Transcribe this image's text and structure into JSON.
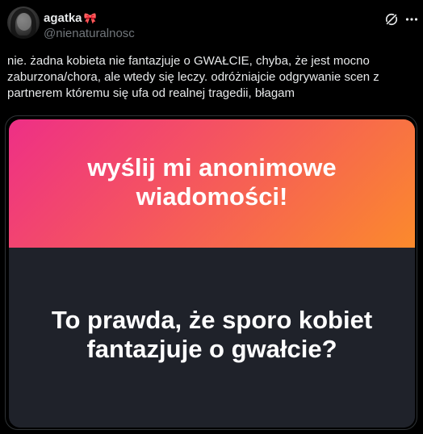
{
  "post": {
    "author": {
      "display_name": "agatka",
      "badge_icon": "ribbon-bow-icon",
      "handle": "@nienaturalnosc"
    },
    "header_icons": [
      "grok-icon",
      "more-options-icon"
    ],
    "text": "nie. żadna kobieta nie fantazjuje o GWAŁCIE, chyba, że jest mocno zaburzona/chora, ale wtedy się leczy. odróżniajcie odgrywanie scen z partnerem któremu się ufa od realnej tragedii, błagam",
    "media": {
      "card_title": "wyślij mi anonimowe wiadomości!",
      "question": "To prawda, że sporo kobiet fantazjuje o gwałcie?"
    }
  },
  "colors": {
    "background": "#000000",
    "text_primary": "#e7e9ea",
    "text_secondary": "#71767b",
    "bow": "#e8324f",
    "gradient_start": "#ee2f86",
    "gradient_end": "#fb8a2c",
    "card_dark": "#1f222a"
  }
}
